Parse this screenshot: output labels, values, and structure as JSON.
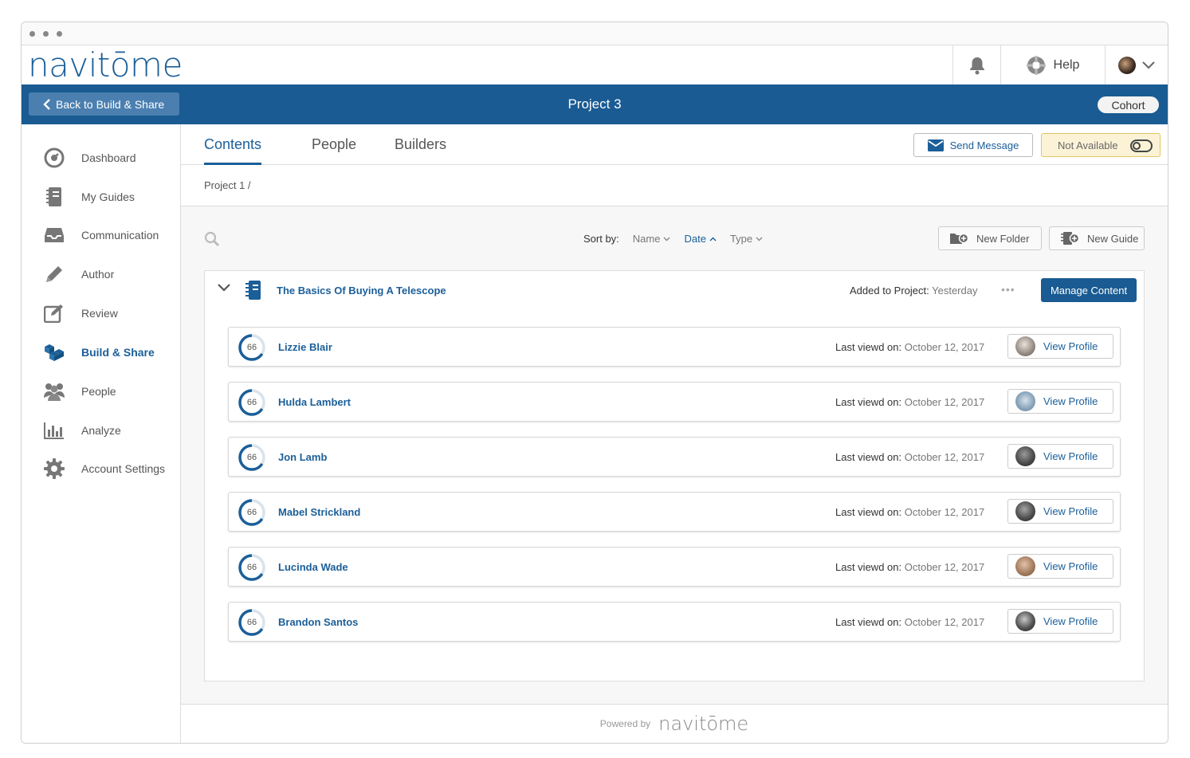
{
  "app": {
    "logo_text": "navitōme"
  },
  "top_bar": {
    "help_label": "Help"
  },
  "blue_bar": {
    "back_label": "Back to Build & Share",
    "project_title": "Project 3",
    "cohort_label": "Cohort"
  },
  "sidebar": {
    "items": [
      {
        "label": "Dashboard",
        "icon": "dashboard-icon"
      },
      {
        "label": "My Guides",
        "icon": "guides-icon"
      },
      {
        "label": "Communication",
        "icon": "inbox-icon"
      },
      {
        "label": "Author",
        "icon": "pencil-icon"
      },
      {
        "label": "Review",
        "icon": "review-icon"
      },
      {
        "label": "Build & Share",
        "icon": "blocks-icon",
        "active": true
      },
      {
        "label": "People",
        "icon": "people-icon"
      },
      {
        "label": "Analyze",
        "icon": "bar-chart-icon"
      },
      {
        "label": "Account Settings",
        "icon": "gear-icon"
      }
    ]
  },
  "tabs": {
    "contents": "Contents",
    "people": "People",
    "builders": "Builders",
    "active": "Contents"
  },
  "actions": {
    "send_message": "Send Message",
    "availability": "Not Available"
  },
  "breadcrumb": "Project 1 /",
  "toolbar": {
    "sort_by_label": "Sort by:",
    "sort_name": "Name",
    "sort_date": "Date",
    "sort_type": "Type",
    "new_folder": "New Folder",
    "new_guide": "New Guide"
  },
  "guide": {
    "title": "The Basics Of Buying A Telescope",
    "added_label": "Added to Project:",
    "added_value": "Yesterday",
    "more_label": "•••",
    "manage_label": "Manage Content",
    "last_viewed_label": "Last viewd on:",
    "view_profile_label": "View Profile",
    "people": [
      {
        "name": "Lizzie Blair",
        "progress": "66",
        "last_viewed": "October 12, 2017"
      },
      {
        "name": "Hulda Lambert",
        "progress": "66",
        "last_viewed": "October 12, 2017"
      },
      {
        "name": "Jon Lamb",
        "progress": "66",
        "last_viewed": "October 12, 2017"
      },
      {
        "name": "Mabel Strickland",
        "progress": "66",
        "last_viewed": "October 12, 2017"
      },
      {
        "name": "Lucinda Wade",
        "progress": "66",
        "last_viewed": "October 12, 2017"
      },
      {
        "name": "Brandon Santos",
        "progress": "66",
        "last_viewed": "October 12, 2017"
      }
    ]
  },
  "footer": {
    "powered_by": "Powered by",
    "logo_text": "navitōme"
  },
  "colors": {
    "brand": "#195b92",
    "accent_light": "#4a7fb0",
    "warning_bg": "#fcf3d7"
  }
}
